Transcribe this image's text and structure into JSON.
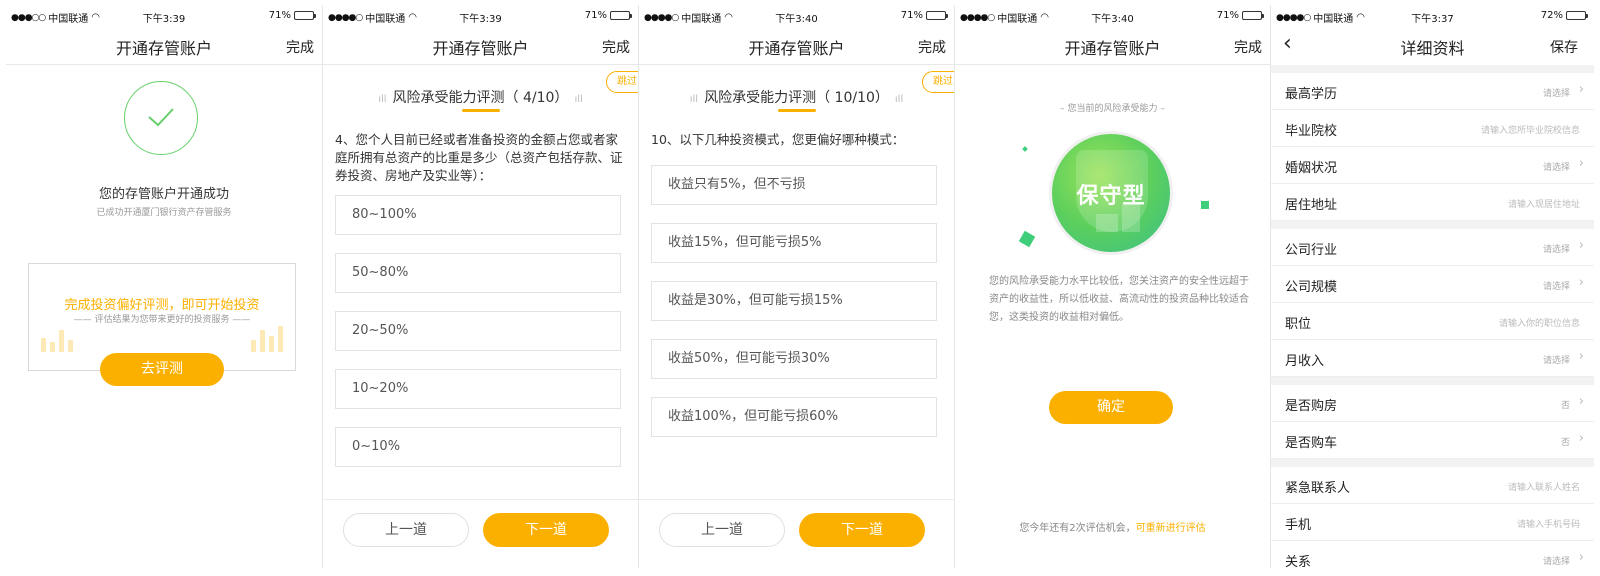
{
  "statusbars": [
    {
      "carrier": "中国联通",
      "time": "下午3:39",
      "battery": "71%",
      "battery_level": 0.71
    },
    {
      "carrier": "中国联通",
      "time": "下午3:39",
      "battery": "71%",
      "battery_level": 0.71
    },
    {
      "carrier": "中国联通",
      "time": "下午3:40",
      "battery": "71%",
      "battery_level": 0.71
    },
    {
      "carrier": "中国联通",
      "time": "下午3:40",
      "battery": "71%",
      "battery_level": 0.71
    },
    {
      "carrier": "中国联通",
      "time": "下午3:37",
      "battery": "72%",
      "battery_level": 0.72
    }
  ],
  "screen1": {
    "title": "开通存管账户",
    "done": "完成",
    "success_title": "您的存管账户开通成功",
    "success_sub": "已成功开通厦门银行资产存管服务",
    "eval_main": "完成投资偏好评测，即可开始投资",
    "eval_sub": "评估结果为您带来更好的投资服务",
    "eval_button": "去评测"
  },
  "screen2": {
    "title": "开通存管账户",
    "done": "完成",
    "skip": "跳过",
    "heading": "风险承受能力评测（ 4/10）",
    "question": "4、您个人目前已经或者准备投资的金额占您或者家庭所拥有总资产的比重是多少（总资产包括存款、证券投资、房地产及实业等）：",
    "options": [
      "80~100%",
      "50~80%",
      "20~50%",
      "10~20%",
      "0~10%"
    ],
    "prev": "上一道",
    "next": "下一道"
  },
  "screen3": {
    "title": "开通存管账户",
    "done": "完成",
    "skip": "跳过",
    "heading": "风险承受能力评测（ 10/10）",
    "question": "10、以下几种投资模式，您更偏好哪种模式：",
    "options": [
      "收益只有5%，但不亏损",
      "收益15%，但可能亏损5%",
      "收益是30%，但可能亏损15%",
      "收益50%，但可能亏损30%",
      "收益100%，但可能亏损60%"
    ],
    "prev": "上一道",
    "next": "下一道"
  },
  "screen4": {
    "title": "开通存管账户",
    "done": "完成",
    "current_label": "– 您当前的风险承受能力 –",
    "badge": "保守型",
    "description": "您的风险承受能力水平比较低，您关注资产的安全性远超于资产的收益性，所以低收益、高流动性的投资品种比较适合您，这类投资的收益相对偏低。",
    "confirm": "确定",
    "chance_text": "您今年还有2次评估机会，",
    "chance_link": "可重新进行评估"
  },
  "screen5": {
    "title": "详细资料",
    "back": "‹",
    "save": "保存",
    "groups": [
      [
        {
          "label": "最高学历",
          "value": "请选择",
          "type": "select"
        },
        {
          "label": "毕业院校",
          "value": "请输入您所毕业院校信息",
          "type": "input"
        },
        {
          "label": "婚姻状况",
          "value": "请选择",
          "type": "select"
        },
        {
          "label": "居住地址",
          "value": "请输入现居住地址",
          "type": "input"
        }
      ],
      [
        {
          "label": "公司行业",
          "value": "请选择",
          "type": "select"
        },
        {
          "label": "公司规模",
          "value": "请选择",
          "type": "select"
        },
        {
          "label": "职位",
          "value": "请输入你的职位信息",
          "type": "input"
        },
        {
          "label": "月收入",
          "value": "请选择",
          "type": "select"
        }
      ],
      [
        {
          "label": "是否购房",
          "value": "否",
          "type": "select"
        },
        {
          "label": "是否购车",
          "value": "否",
          "type": "select"
        }
      ],
      [
        {
          "label": "紧急联系人",
          "value": "请输入联系人姓名",
          "type": "input"
        },
        {
          "label": "手机",
          "value": "请输入手机号码",
          "type": "input"
        },
        {
          "label": "关系",
          "value": "请选择",
          "type": "select"
        }
      ]
    ]
  },
  "colors": {
    "accent": "#fbb000",
    "success": "#65d06a",
    "badge_green": "#5ccf5c"
  }
}
